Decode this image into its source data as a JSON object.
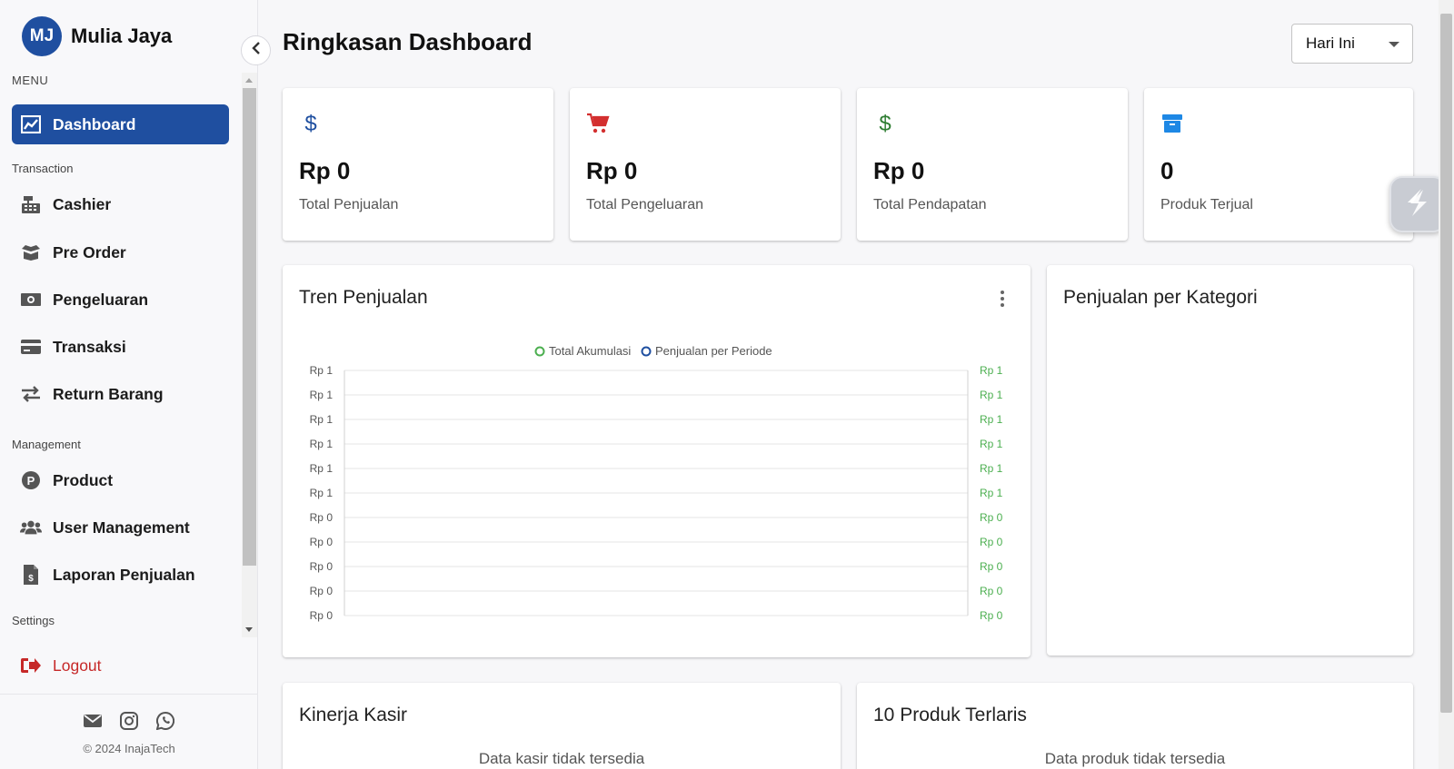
{
  "brand": {
    "initials": "MJ",
    "name": "Mulia Jaya"
  },
  "sidebar": {
    "menu_label": "MENU",
    "dashboard": {
      "label": "Dashboard",
      "icon": "chart-line-icon"
    },
    "sections": {
      "transaction": "Transaction",
      "management": "Management",
      "settings": "Settings"
    },
    "transaction_items": [
      {
        "label": "Cashier",
        "icon": "cash-register-icon"
      },
      {
        "label": "Pre Order",
        "icon": "box-open-icon"
      },
      {
        "label": "Pengeluaran",
        "icon": "money-bill-icon"
      },
      {
        "label": "Transaksi",
        "icon": "credit-card-icon"
      },
      {
        "label": "Return Barang",
        "icon": "exchange-arrows-icon"
      }
    ],
    "management_items": [
      {
        "label": "Product",
        "icon": "product-p-icon"
      },
      {
        "label": "User Management",
        "icon": "users-icon"
      },
      {
        "label": "Laporan Penjualan",
        "icon": "invoice-dollar-icon"
      }
    ],
    "logout": {
      "label": "Logout",
      "icon": "sign-out-icon",
      "color": "#c62828"
    },
    "footer": {
      "icons": [
        "mail-icon",
        "instagram-icon",
        "whatsapp-icon"
      ],
      "copyright": "© 2024 InajaTech"
    }
  },
  "header": {
    "title": "Ringkasan Dashboard",
    "period": {
      "value": "Hari Ini"
    }
  },
  "stats": [
    {
      "value": "Rp 0",
      "label": "Total Penjualan",
      "icon": "dollar-icon",
      "color": "#1f4fa0"
    },
    {
      "value": "Rp 0",
      "label": "Total Pengeluaran",
      "icon": "shopping-cart-icon",
      "color": "#d32f2f"
    },
    {
      "value": "Rp 0",
      "label": "Total Pendapatan",
      "icon": "dollar-icon",
      "color": "#2e7d32"
    },
    {
      "value": "0",
      "label": "Produk Terjual",
      "icon": "archive-box-icon",
      "color": "#1e88e5"
    }
  ],
  "sales_trend": {
    "title": "Tren Penjualan",
    "chart_data": {
      "type": "line",
      "title": "",
      "series": [
        {
          "name": "Total Akumulasi",
          "color": "#4caf50",
          "values": []
        },
        {
          "name": "Penjualan per Periode",
          "color": "#1f4fa0",
          "values": []
        }
      ],
      "y_ticks_left": [
        "Rp 1",
        "Rp 1",
        "Rp 1",
        "Rp 1",
        "Rp 1",
        "Rp 1",
        "Rp 0",
        "Rp 0",
        "Rp 0",
        "Rp 0",
        "Rp 0"
      ],
      "y_ticks_right": [
        "Rp 1",
        "Rp 1",
        "Rp 1",
        "Rp 1",
        "Rp 1",
        "Rp 1",
        "Rp 0",
        "Rp 0",
        "Rp 0",
        "Rp 0",
        "Rp 0"
      ],
      "right_tick_color": "#4caf50",
      "legend": "top-center",
      "grid": true
    }
  },
  "category_sales": {
    "title": "Penjualan per Kategori"
  },
  "cashier_performance": {
    "title": "Kinerja Kasir",
    "empty": "Data kasir tidak tersedia"
  },
  "top_products": {
    "title": "10 Produk Terlaris",
    "empty": "Data produk tidak tersedia"
  }
}
